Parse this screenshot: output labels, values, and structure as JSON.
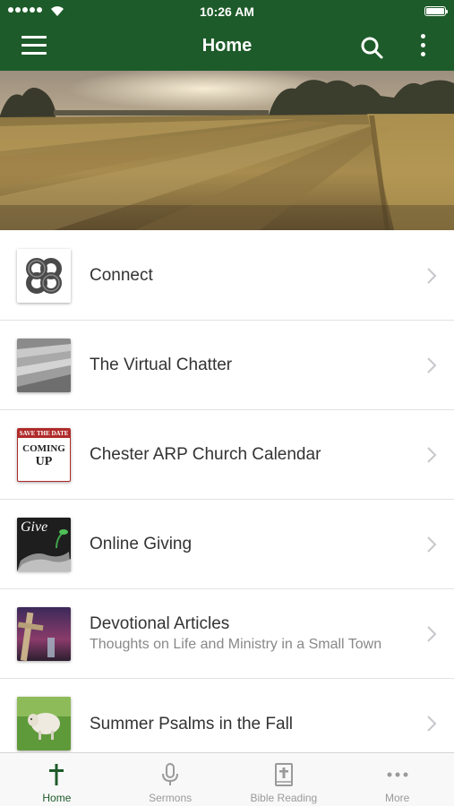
{
  "status_bar": {
    "time": "10:26 AM"
  },
  "nav": {
    "title": "Home",
    "menu_icon": "hamburger-menu-icon",
    "search_icon": "search-icon",
    "more_icon": "vertical-dots-icon"
  },
  "colors": {
    "brand": "#1e5b2a",
    "tab_active": "#1e5b2a",
    "tab_inactive": "#9a9a9a"
  },
  "hero": {
    "image": "wheat-field-sunset"
  },
  "list": [
    {
      "title": "Connect",
      "subtitle": "",
      "thumb": "celtic-knot-logo"
    },
    {
      "title": "The Virtual Chatter",
      "subtitle": "",
      "thumb": "stacked-paper"
    },
    {
      "title": "Chester ARP Church Calendar",
      "subtitle": "",
      "thumb": "save-the-date-coming-up",
      "thumb_text": {
        "top": "SAVE THE DATE",
        "mid": "COMING",
        "bottom": "UP"
      }
    },
    {
      "title": "Online Giving",
      "subtitle": "",
      "thumb": "give-hands-seedling",
      "thumb_text": "Give"
    },
    {
      "title": "Devotional Articles",
      "subtitle": "Thoughts on Life and Ministry in a Small Town",
      "thumb": "cross-sunset"
    },
    {
      "title": "Summer Psalms in the Fall",
      "subtitle": "",
      "thumb": "sheep-field"
    }
  ],
  "tabs": [
    {
      "label": "Home",
      "icon": "cross-icon",
      "active": true
    },
    {
      "label": "Sermons",
      "icon": "microphone-icon",
      "active": false
    },
    {
      "label": "Bible Reading",
      "icon": "bible-icon",
      "active": false
    },
    {
      "label": "More",
      "icon": "horizontal-dots-icon",
      "active": false
    }
  ]
}
